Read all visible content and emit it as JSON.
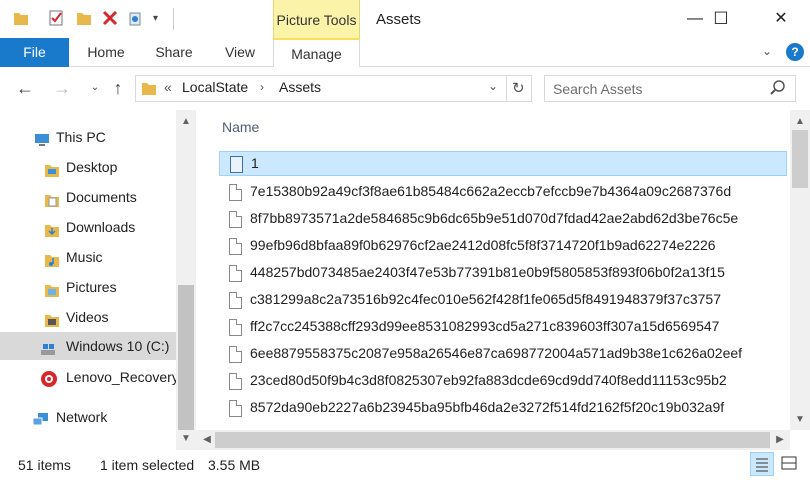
{
  "window": {
    "title": "Assets",
    "context_tab_group": "Picture Tools",
    "minimize": "—",
    "maximize": "☐",
    "close": "✕"
  },
  "ribbon": {
    "tabs": [
      "File",
      "Home",
      "Share",
      "View",
      "Manage"
    ],
    "active_context_tab": "Manage"
  },
  "address": {
    "separator_prefix": "«",
    "path": [
      "LocalState",
      "Assets"
    ]
  },
  "search": {
    "placeholder": "Search Assets"
  },
  "nav_pane": {
    "items": [
      {
        "label": "This PC",
        "icon": "computer-icon"
      },
      {
        "label": "Desktop",
        "icon": "folder-icon"
      },
      {
        "label": "Documents",
        "icon": "folder-icon"
      },
      {
        "label": "Downloads",
        "icon": "folder-icon"
      },
      {
        "label": "Music",
        "icon": "folder-icon"
      },
      {
        "label": "Pictures",
        "icon": "folder-icon"
      },
      {
        "label": "Videos",
        "icon": "folder-icon"
      },
      {
        "label": "Windows 10 (C:)",
        "icon": "drive-icon",
        "selected": true
      },
      {
        "label": "Lenovo_Recovery",
        "icon": "recovery-drive-icon"
      },
      {
        "label": "Network",
        "icon": "network-icon"
      }
    ]
  },
  "file_list": {
    "column_header": "Name",
    "rows": [
      {
        "name": "1",
        "selected": true,
        "icon": "image-file-icon"
      },
      {
        "name": "7e15380b92a49cf3f8ae61b85484c662a2eccb7efccb9e7b4364a09c2687376d"
      },
      {
        "name": "8f7bb8973571a2de584685c9b6dc65b9e51d070d7fdad42ae2abd62d3be76c5e"
      },
      {
        "name": "99efb96d8bfaa89f0b62976cf2ae2412d08fc5f8f3714720f1b9ad62274e2226"
      },
      {
        "name": "448257bd073485ae2403f47e53b77391b81e0b9f5805853f893f06b0f2a13f15"
      },
      {
        "name": "c381299a8c2a73516b92c4fec010e562f428f1fe065d5f8491948379f37c3757"
      },
      {
        "name": "ff2c7cc245388cff293d99ee8531082993cd5a271c839603ff307a15d6569547"
      },
      {
        "name": "6ee8879558375c2087e958a26546e87ca698772004a571ad9b38e1c626a02eef"
      },
      {
        "name": "23ced80d50f9b4c3d8f0825307eb92fa883dcde69cd9dd740f8edd11153c95b2"
      },
      {
        "name": "8572da90eb2227a6b23945ba95bfb46da2e3272f514fd2162f5f20c19b032a9f"
      }
    ]
  },
  "status": {
    "item_count": "51 items",
    "selection": "1 item selected",
    "size": "3.55 MB"
  },
  "colors": {
    "file_tab": "#1979ca",
    "picture_tools": "#fbf3a8",
    "selection_bg": "#cce8ff",
    "selection_border": "#99d1ff"
  }
}
